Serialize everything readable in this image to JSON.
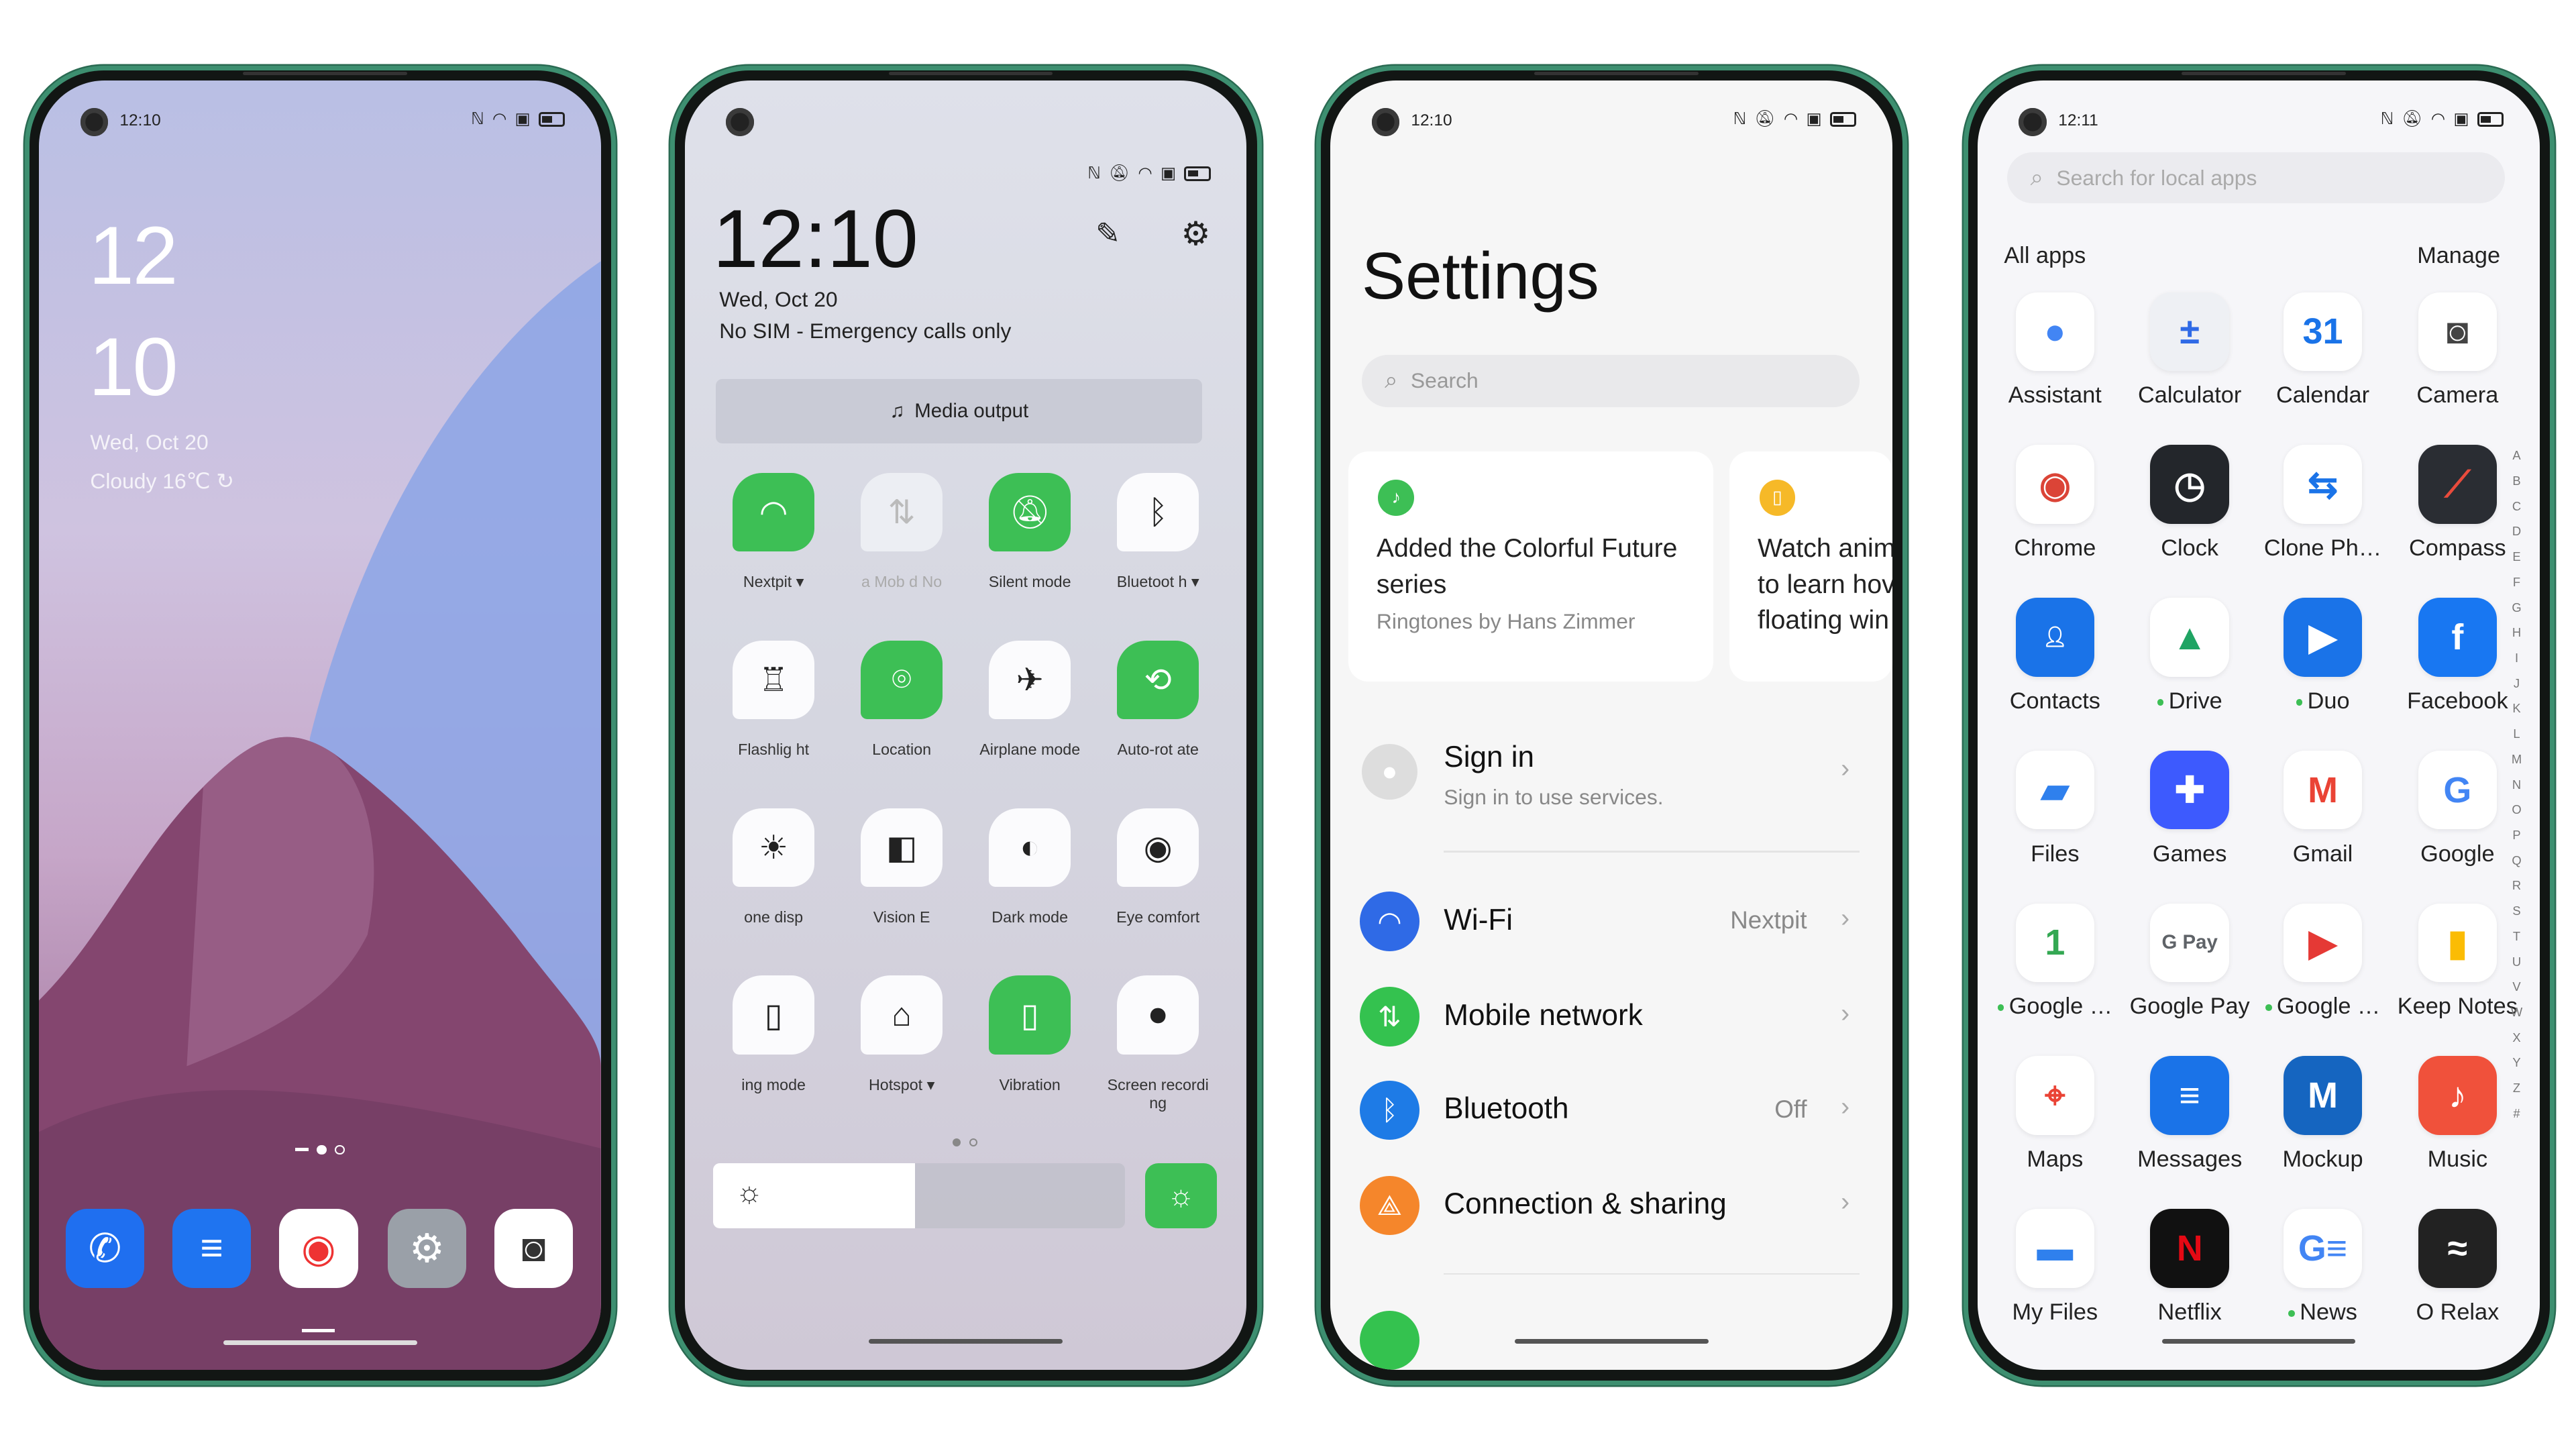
{
  "colors": {
    "accent_green": "#3dbf55",
    "bezel_green": "#3d8f70",
    "wifi_blue": "#2f6ae6",
    "bt_blue": "#1e7be6",
    "orange": "#f5862b"
  },
  "lockscreen": {
    "status_time": "12:10",
    "clock_hour": "12",
    "clock_minute": "10",
    "date": "Wed, Oct 20",
    "weather": "Cloudy  16℃",
    "page_dots": 3,
    "active_dot": 2,
    "dock": [
      {
        "icon": "phone-icon"
      },
      {
        "icon": "messages-icon"
      },
      {
        "icon": "chrome-icon"
      },
      {
        "icon": "settings-icon"
      },
      {
        "icon": "camera-icon"
      }
    ]
  },
  "quick_settings": {
    "time": "12:10",
    "date": "Wed, Oct 20",
    "sim_status": "No SIM - Emergency calls only",
    "media_output": "Media output",
    "brightness_percent": 49,
    "tiles": [
      {
        "label": "Nextpit ▾",
        "icon": "wifi-icon",
        "state": "on"
      },
      {
        "label": "a   Mob d   No",
        "icon": "mobile-data-icon",
        "state": "dim"
      },
      {
        "label": "Silent mode",
        "icon": "silent-icon",
        "state": "on"
      },
      {
        "label": "Bluetoot h ▾",
        "icon": "bluetooth-icon",
        "state": "off"
      },
      {
        "label": "Flashlig ht",
        "icon": "flashlight-icon",
        "state": "off"
      },
      {
        "label": "Location",
        "icon": "location-icon",
        "state": "on"
      },
      {
        "label": "Airplane mode",
        "icon": "airplane-icon",
        "state": "off"
      },
      {
        "label": "Auto-rot ate",
        "icon": "auto-rotate-icon",
        "state": "on"
      },
      {
        "label": "one disp",
        "icon": "tone-display-icon",
        "state": "off"
      },
      {
        "label": "Vision E",
        "icon": "vision-icon",
        "state": "off"
      },
      {
        "label": "Dark mode",
        "icon": "dark-mode-icon",
        "state": "off"
      },
      {
        "label": "Eye comfort",
        "icon": "eye-icon",
        "state": "off"
      },
      {
        "label": "ing mode",
        "icon": "battery-icon",
        "state": "off"
      },
      {
        "label": "Hotspot ▾",
        "icon": "hotspot-icon",
        "state": "off"
      },
      {
        "label": "Vibration",
        "icon": "vibration-icon",
        "state": "on"
      },
      {
        "label": "Screen recording",
        "icon": "screen-record-icon",
        "state": "off"
      }
    ]
  },
  "settings": {
    "status_time": "12:10",
    "title": "Settings",
    "search_placeholder": "Search",
    "cards": [
      {
        "title": "Added the Colorful Future series",
        "subtitle": "Ringtones by Hans Zimmer",
        "icon": "ringtone-icon"
      },
      {
        "lines": [
          "Watch anim",
          "to learn hov",
          "floating win"
        ],
        "icon": "tip-icon"
      }
    ],
    "account": {
      "title": "Sign in",
      "subtitle": "Sign in to use services."
    },
    "rows": [
      {
        "label": "Wi-Fi",
        "value": "Nextpit",
        "icon": "wifi-icon",
        "color": "#2f6ae6"
      },
      {
        "label": "Mobile network",
        "value": "",
        "icon": "mobile-network-icon",
        "color": "#34c24f"
      },
      {
        "label": "Bluetooth",
        "value": "Off",
        "icon": "bluetooth-icon",
        "color": "#1e7be6"
      },
      {
        "label": "Connection & sharing",
        "value": "",
        "icon": "connection-icon",
        "color": "#f5862b"
      }
    ]
  },
  "app_drawer": {
    "status_time": "12:11",
    "search_placeholder": "Search for local apps",
    "section": "All apps",
    "manage": "Manage",
    "apps": [
      {
        "name": "Assistant",
        "icon": "assistant"
      },
      {
        "name": "Calculator",
        "icon": "calculator"
      },
      {
        "name": "Calendar",
        "icon": "calendar"
      },
      {
        "name": "Camera",
        "icon": "camera"
      },
      {
        "name": "Chrome",
        "icon": "chrome"
      },
      {
        "name": "Clock",
        "icon": "clock"
      },
      {
        "name": "Clone Ph…",
        "icon": "clone"
      },
      {
        "name": "Compass",
        "icon": "compass"
      },
      {
        "name": "Contacts",
        "icon": "contacts"
      },
      {
        "name": "Drive",
        "icon": "drive",
        "new": true
      },
      {
        "name": "Duo",
        "icon": "duo",
        "new": true
      },
      {
        "name": "Facebook",
        "icon": "facebook"
      },
      {
        "name": "Files",
        "icon": "files"
      },
      {
        "name": "Games",
        "icon": "games"
      },
      {
        "name": "Gmail",
        "icon": "gmail"
      },
      {
        "name": "Google",
        "icon": "google"
      },
      {
        "name": "Google …",
        "icon": "google-one",
        "new": true
      },
      {
        "name": "Google Pay",
        "icon": "gpay"
      },
      {
        "name": "Google …",
        "icon": "play-movies",
        "new": true
      },
      {
        "name": "Keep Notes",
        "icon": "keep"
      },
      {
        "name": "Maps",
        "icon": "maps"
      },
      {
        "name": "Messages",
        "icon": "messages"
      },
      {
        "name": "Mockup",
        "icon": "mockup"
      },
      {
        "name": "Music",
        "icon": "music"
      },
      {
        "name": "My Files",
        "icon": "myfiles"
      },
      {
        "name": "Netflix",
        "icon": "netflix"
      },
      {
        "name": "News",
        "icon": "news",
        "new": true
      },
      {
        "name": "O Relax",
        "icon": "orelax"
      }
    ],
    "alphabet": [
      "A",
      "B",
      "C",
      "D",
      "E",
      "F",
      "G",
      "H",
      "I",
      "J",
      "K",
      "L",
      "M",
      "N",
      "O",
      "P",
      "Q",
      "R",
      "S",
      "T",
      "U",
      "V",
      "W",
      "X",
      "Y",
      "Z",
      "#"
    ]
  }
}
